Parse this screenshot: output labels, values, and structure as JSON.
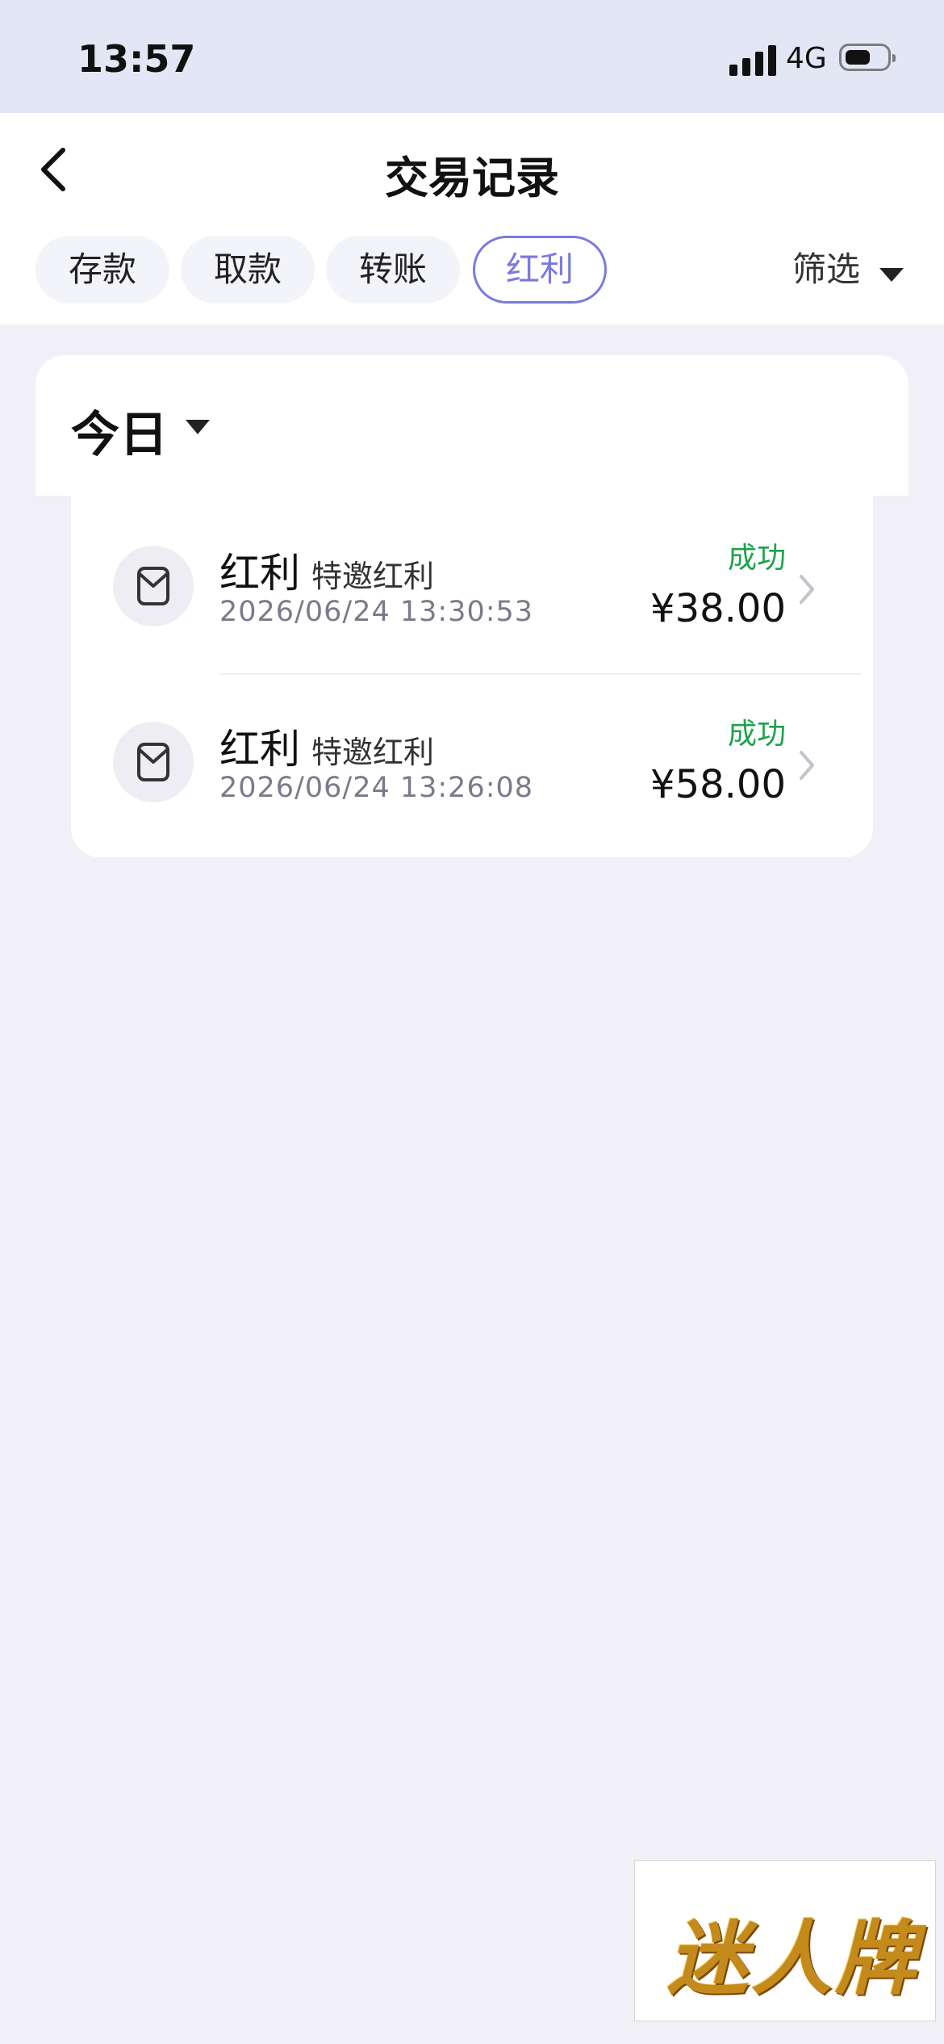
{
  "status_bar": {
    "time": "13:57",
    "network": "4G"
  },
  "header": {
    "title": "交易记录"
  },
  "tabs": [
    {
      "label": "存款",
      "active": false
    },
    {
      "label": "取款",
      "active": false
    },
    {
      "label": "转账",
      "active": false
    },
    {
      "label": "红利",
      "active": true
    }
  ],
  "filter": {
    "label": "筛选"
  },
  "section": {
    "label": "今日"
  },
  "transactions": [
    {
      "type": "红利",
      "subtype": "特邀红利",
      "datetime": "2026/06/24 13:30:53",
      "status": "成功",
      "amount": "¥38.00"
    },
    {
      "type": "红利",
      "subtype": "特邀红利",
      "datetime": "2026/06/24 13:26:08",
      "status": "成功",
      "amount": "¥58.00"
    }
  ],
  "watermark": {
    "text": "迷人牌"
  },
  "colors": {
    "accent": "#7b79e0",
    "success": "#1ea34d",
    "status_bar_bg": "#e3e6f4",
    "page_bg": "#f0f0f6"
  }
}
